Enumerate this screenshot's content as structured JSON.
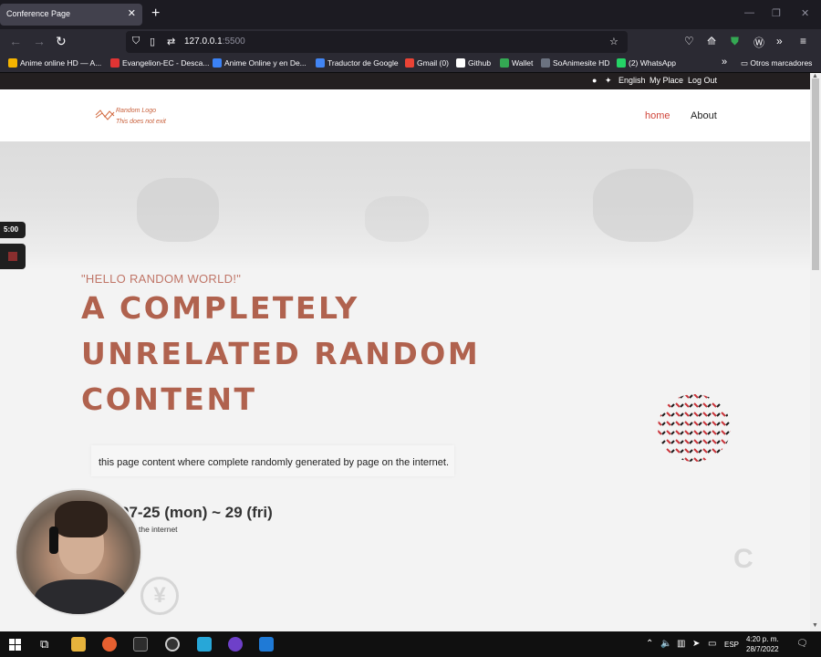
{
  "browser": {
    "tab_title": "Conference Page",
    "tab_close": "✕",
    "new_tab": "+",
    "url_host": "127.0.0.1",
    "url_port": ":5500",
    "bookmarks": [
      {
        "label": "Anime online HD — A...",
        "color": "#f5b400"
      },
      {
        "label": "Evangelion-EC - Desca...",
        "color": "#e03434"
      },
      {
        "label": "Anime Online y en De...",
        "color": "#3b82f6"
      },
      {
        "label": "Traductor de Google",
        "color": "#4285f4"
      },
      {
        "label": "Gmail (0)",
        "color": "#ea4335"
      },
      {
        "label": "Github",
        "color": "#ffffff"
      },
      {
        "label": "Wallet",
        "color": "#34a853"
      },
      {
        "label": "SoAnimesite HD",
        "color": "#6b7280"
      },
      {
        "label": "(2) WhatsApp",
        "color": "#25d366"
      }
    ],
    "other_bookmarks": "Otros marcadores"
  },
  "site": {
    "top_links": {
      "language": "English",
      "my_place": "My Place",
      "logout": "Log Out"
    },
    "logo_line1": "Random Logo",
    "logo_line2": "This does not exit",
    "nav": {
      "home": "home",
      "about": "About"
    },
    "hero": {
      "tagline": "\"HELLO RANDOM WORLD!\"",
      "headline_1": "A COMPLETELY",
      "headline_2": "UNRELATED RANDOM",
      "headline_3": "CONTENT",
      "description": "this page content where complete randomly generated by page on the internet.",
      "date": "07-25 (mon) ~ 29 (fri)",
      "location": "the internet"
    },
    "accent_color": "#d0453a"
  },
  "recorder": {
    "timer": "5:00"
  },
  "taskbar": {
    "lang": "ESP",
    "time": "4:20 p. m.",
    "date": "28/7/2022"
  }
}
